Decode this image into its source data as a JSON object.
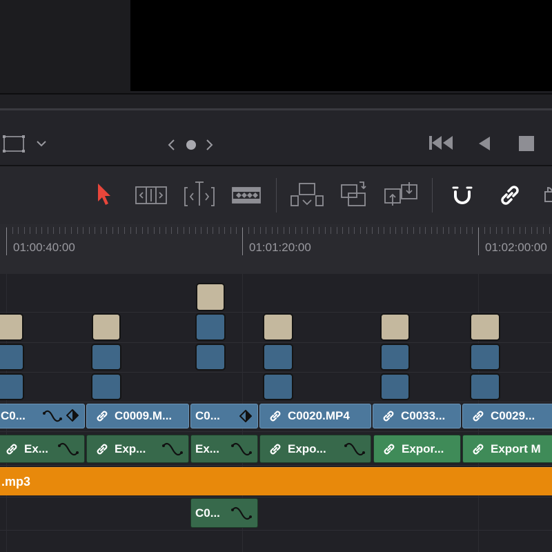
{
  "ruler": {
    "timecodes": [
      "01:00:40:00",
      "01:01:20:00",
      "01:02:00:00"
    ]
  },
  "video_clips": [
    {
      "label": "C0..."
    },
    {
      "label": "C0009.M..."
    },
    {
      "label": "C0..."
    },
    {
      "label": "C0020.MP4"
    },
    {
      "label": "C0033..."
    },
    {
      "label": "C0029..."
    }
  ],
  "audio_clips": [
    {
      "label": "Ex..."
    },
    {
      "label": "Exp..."
    },
    {
      "label": "Ex..."
    },
    {
      "label": "Expo..."
    },
    {
      "label": "Expor..."
    },
    {
      "label": "Export M"
    }
  ],
  "music_track": {
    "label": ".mp3"
  },
  "lower_clip": {
    "label": "C0..."
  },
  "colors": {
    "accent_red": "#e8463b",
    "clip_blue": "#4c789c",
    "clip_green": "#37694b",
    "audio_orange": "#e8890b"
  },
  "icons": [
    "crop-icon",
    "chevron-down-icon",
    "prev-arrow-icon",
    "dot-icon",
    "next-arrow-icon",
    "go-to-start-icon",
    "play-reverse-icon",
    "stop-icon",
    "selection-pointer-icon",
    "trim-edit-icon",
    "dynamic-trim-icon",
    "blade-icon",
    "insert-clip-icon",
    "overwrite-clip-icon",
    "replace-clip-icon",
    "snapping-icon",
    "linked-selection-icon",
    "lock-icon"
  ]
}
